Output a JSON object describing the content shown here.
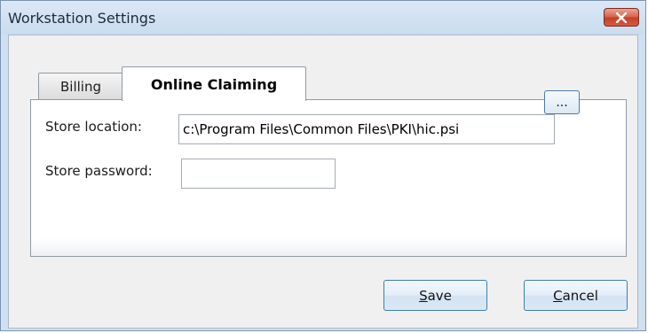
{
  "window": {
    "title": "Workstation Settings"
  },
  "tabs": [
    {
      "label": "Billing",
      "selected": false
    },
    {
      "label": "Online Claiming",
      "selected": true
    }
  ],
  "form": {
    "store_location_label": "Store location:",
    "store_location_value": "c:\\Program Files\\Common Files\\PKI\\hic.psi",
    "browse_label": "...",
    "store_password_label": "Store password:",
    "store_password_value": ""
  },
  "buttons": {
    "save_accel": "S",
    "save_rest": "ave",
    "cancel_accel": "C",
    "cancel_rest": "ancel"
  },
  "icons": {
    "close": "close-icon"
  },
  "colors": {
    "titlebar": "#cadcef",
    "close_button": "#c3402a",
    "button_border": "#3c7fb1"
  }
}
